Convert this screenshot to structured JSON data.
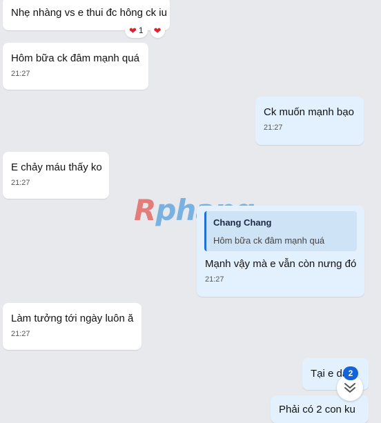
{
  "messages": [
    {
      "text": "Nhẹ nhàng vs e thui đc hông ck iu",
      "time": null,
      "reactions": [
        {
          "emoji": "heart",
          "count": "1"
        },
        {
          "emoji": "heart",
          "count": null
        }
      ]
    },
    {
      "text": "Hôm bữa ck đâm mạnh quá",
      "time": "21:27"
    },
    {
      "text": "Ck muốn mạnh bạo",
      "time": "21:27"
    },
    {
      "text": "E chảy máu thấy ko",
      "time": "21:27"
    },
    {
      "quote": {
        "author": "Chang Chang",
        "text": "Hôm bữa ck đâm mạnh quá"
      },
      "text": "Mạnh vậy mà e vẫn còn nưng đó",
      "time": "21:27"
    },
    {
      "text": "Làm tưởng tới ngày luôn ă",
      "time": "21:27"
    },
    {
      "text": "Tại e dâ",
      "time": null
    },
    {
      "text": "Phải có 2 con ku",
      "time": null
    }
  ],
  "watermark": "Rphang",
  "scroll_down": {
    "badge": "2",
    "icon": "double-chevron-down-icon"
  },
  "colors": {
    "incoming": "#ffffff",
    "outgoing": "#e3f0fd",
    "background": "#e8e9ed",
    "accent": "#1463d8",
    "reaction": "#e11d2e"
  }
}
